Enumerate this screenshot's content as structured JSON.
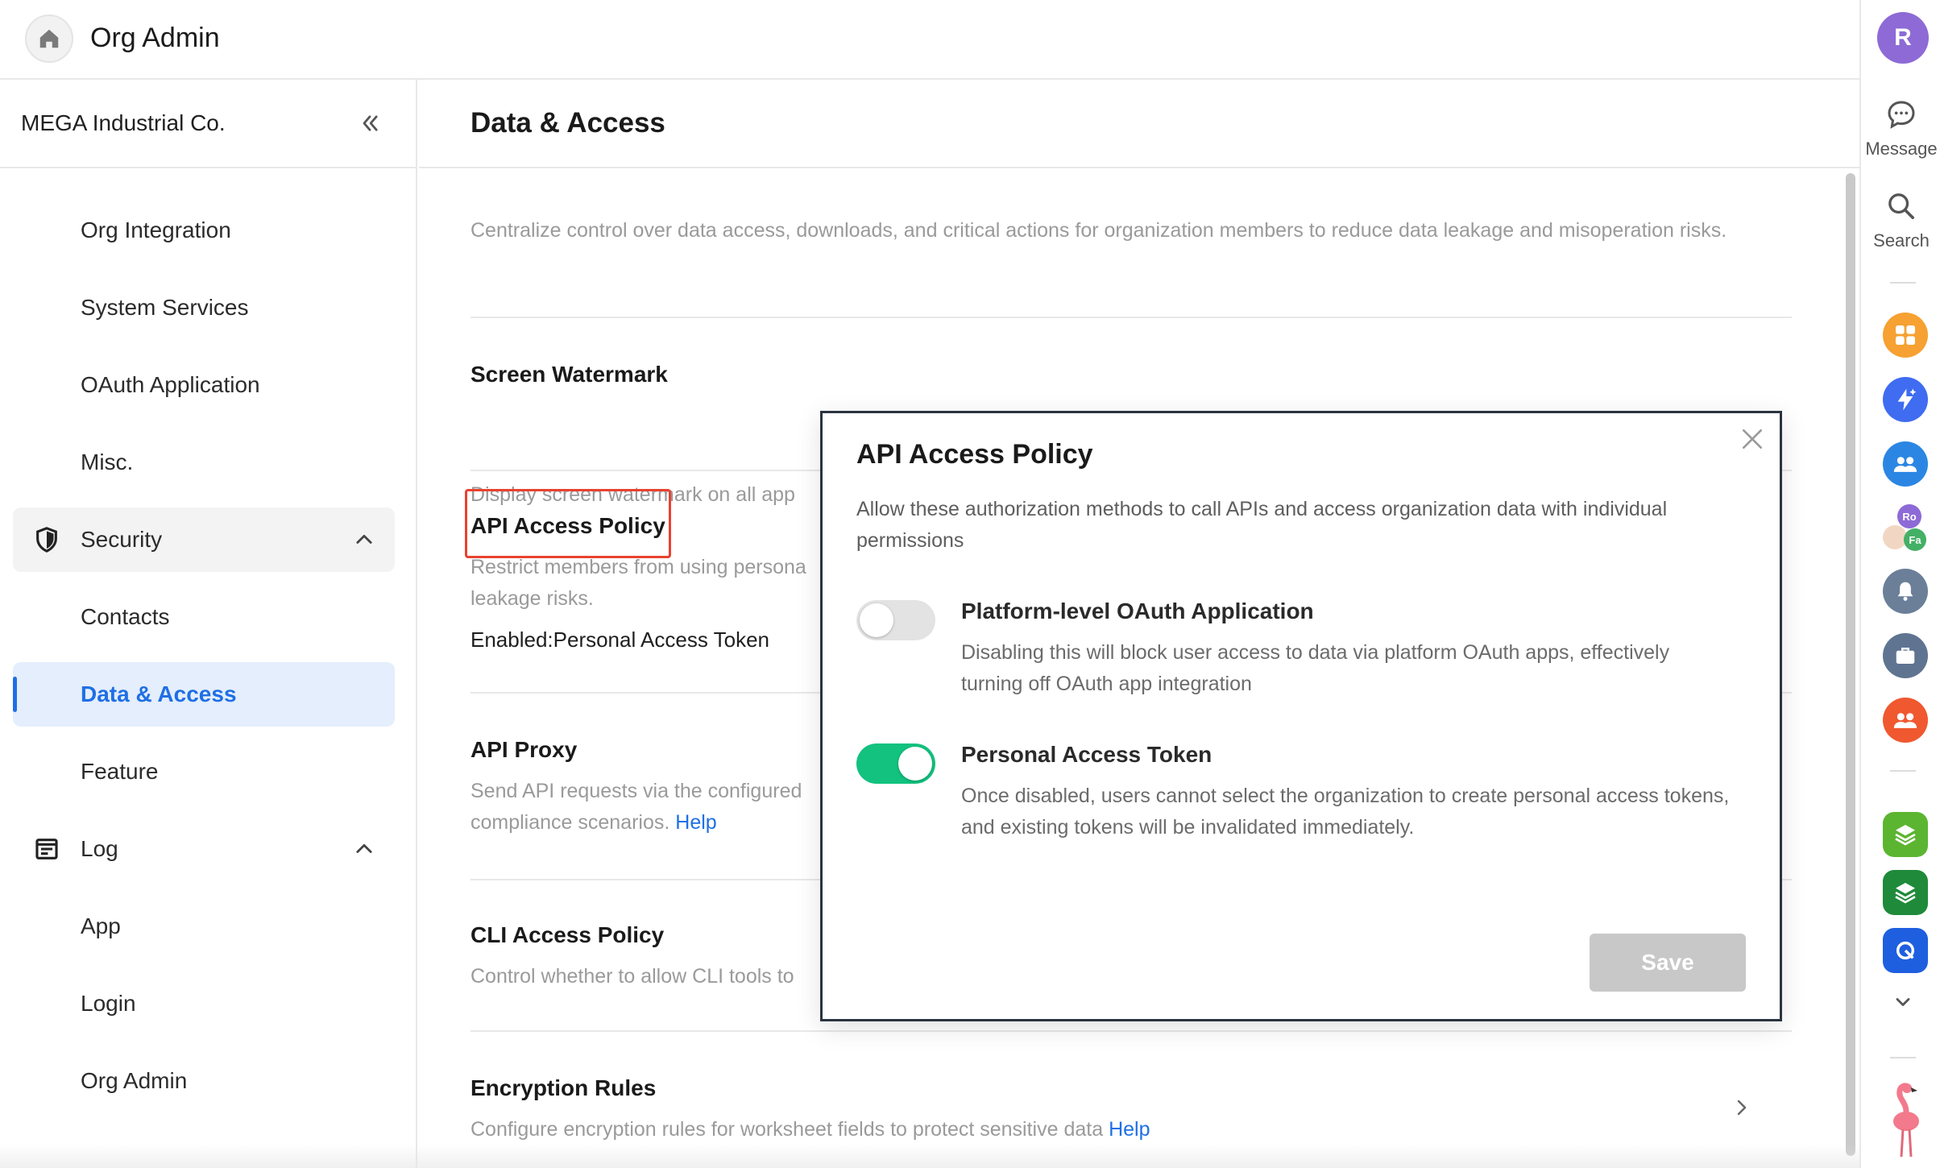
{
  "app": {
    "title": "Org Admin"
  },
  "sidebar": {
    "org_name": "MEGA Industrial Co.",
    "items": [
      {
        "label": "Org Integration"
      },
      {
        "label": "System Services"
      },
      {
        "label": "OAuth Application"
      },
      {
        "label": "Misc."
      },
      {
        "label": "Security",
        "icon": "shield-icon",
        "expanded": true
      },
      {
        "label": "Contacts"
      },
      {
        "label": "Data & Access",
        "active": true
      },
      {
        "label": "Feature"
      },
      {
        "label": "Log",
        "icon": "log-icon",
        "expanded": true
      },
      {
        "label": "App"
      },
      {
        "label": "Login"
      },
      {
        "label": "Org Admin"
      }
    ]
  },
  "main": {
    "title": "Data & Access",
    "intro": "Centralize control over data access, downloads, and critical actions for organization members to reduce data leakage and misoperation risks.",
    "sections": [
      {
        "title": "Screen Watermark",
        "desc": "Display screen watermark on all app"
      },
      {
        "title": "API Access Policy",
        "desc_line1": "Restrict members from using persona",
        "desc_line2": "leakage risks.",
        "extra": "Enabled:Personal Access Token"
      },
      {
        "title": "API Proxy",
        "desc_line1": "Send API requests via the configured",
        "desc_line2": "compliance scenarios.",
        "help": "Help"
      },
      {
        "title": "CLI Access Policy",
        "desc": "Control whether to allow CLI tools to"
      },
      {
        "title": "Encryption Rules",
        "desc": "Configure encryption rules for worksheet fields to protect sensitive data",
        "help": "Help"
      }
    ]
  },
  "rail": {
    "avatar": "R",
    "message_label": "Message",
    "search_label": "Search",
    "mini_avatars": [
      "Ro",
      "Fa"
    ]
  },
  "modal": {
    "title": "API Access Policy",
    "desc": "Allow these authorization methods to call APIs and access organization data with individual permissions",
    "options": [
      {
        "title": "Platform-level OAuth Application",
        "desc": "Disabling this will block user access to data via platform OAuth apps, effectively turning off OAuth app integration",
        "enabled": false
      },
      {
        "title": "Personal Access Token",
        "desc": "Once disabled, users cannot select the organization to create personal access tokens, and existing tokens will be invalidated immediately.",
        "enabled": true
      }
    ],
    "save_label": "Save"
  },
  "colors": {
    "accent": "#1f6fe5",
    "toggle_on": "#12c27e",
    "highlight": "#e8422f"
  }
}
